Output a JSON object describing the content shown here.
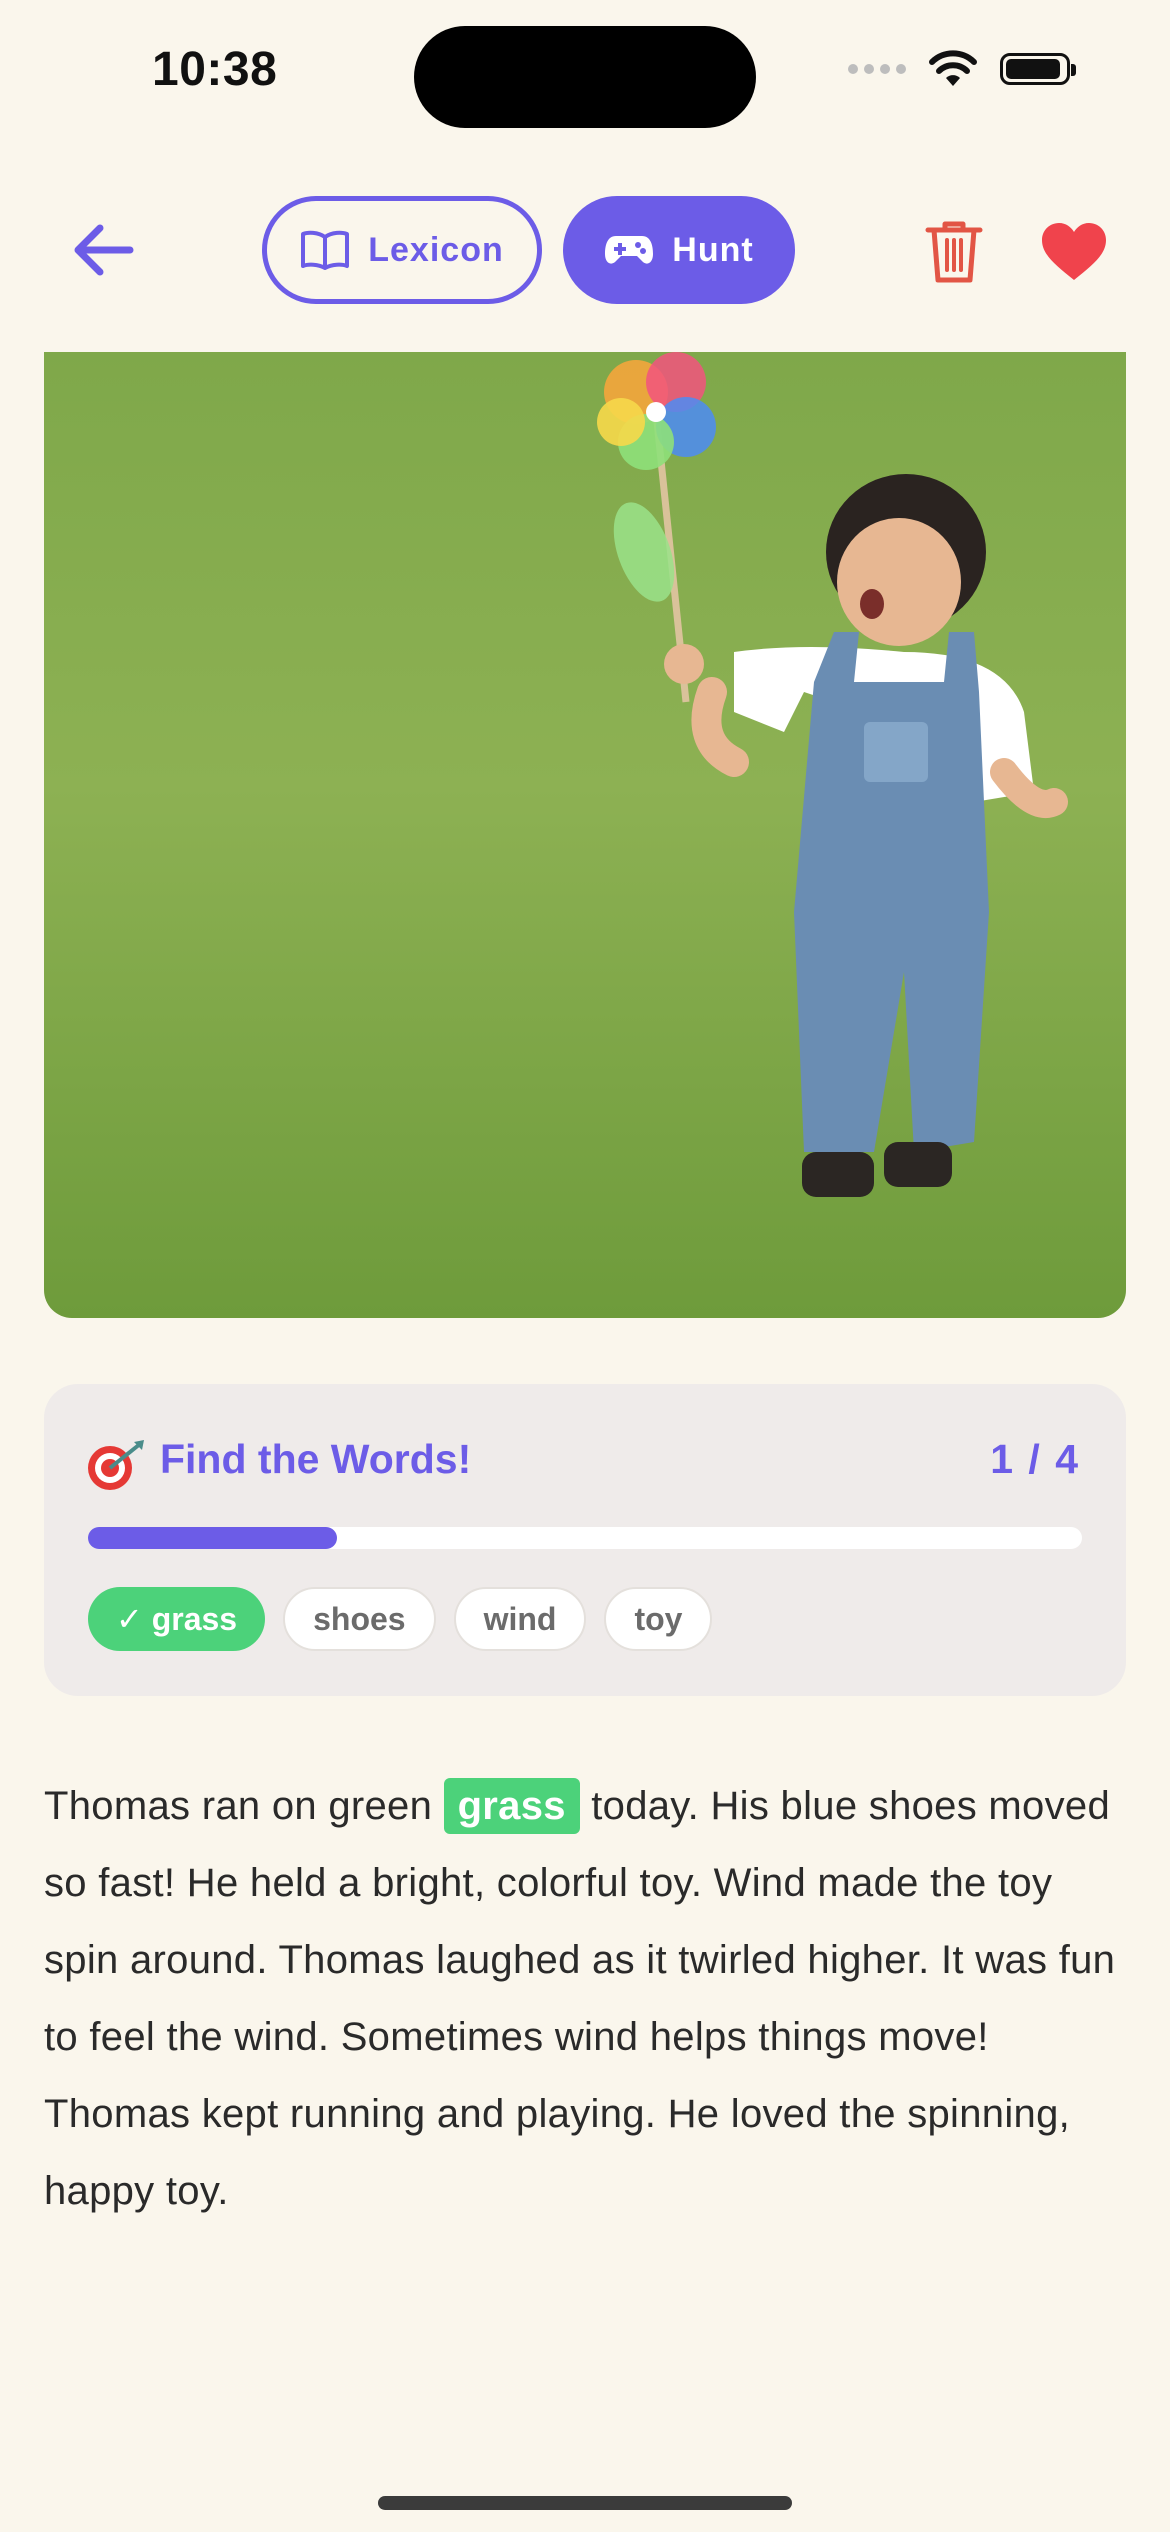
{
  "status_bar": {
    "time": "10:38"
  },
  "nav": {
    "lexicon_label": "Lexicon",
    "hunt_label": "Hunt",
    "accent_color": "#6C5CE7",
    "delete_color": "#E25545",
    "favorite_color": "#F0434C"
  },
  "image": {
    "subject": "child running with pinwheel on grass"
  },
  "game": {
    "title": "Find the Words!",
    "count": "1 / 4",
    "progress": 0.25,
    "words": [
      {
        "label": "✓ grass",
        "found": true
      },
      {
        "label": "shoes",
        "found": false
      },
      {
        "label": "wind",
        "found": false
      },
      {
        "label": "toy",
        "found": false
      }
    ]
  },
  "story": {
    "before": "Thomas ran on green",
    "highlight": "grass",
    "after": "today. His blue shoes moved so fast! He held a bright, colorful toy. Wind made the toy spin around. Thomas laughed as it twirled higher. It was fun to feel the wind. Sometimes wind helps things move! Thomas kept running and playing. He loved the spinning, happy toy."
  }
}
